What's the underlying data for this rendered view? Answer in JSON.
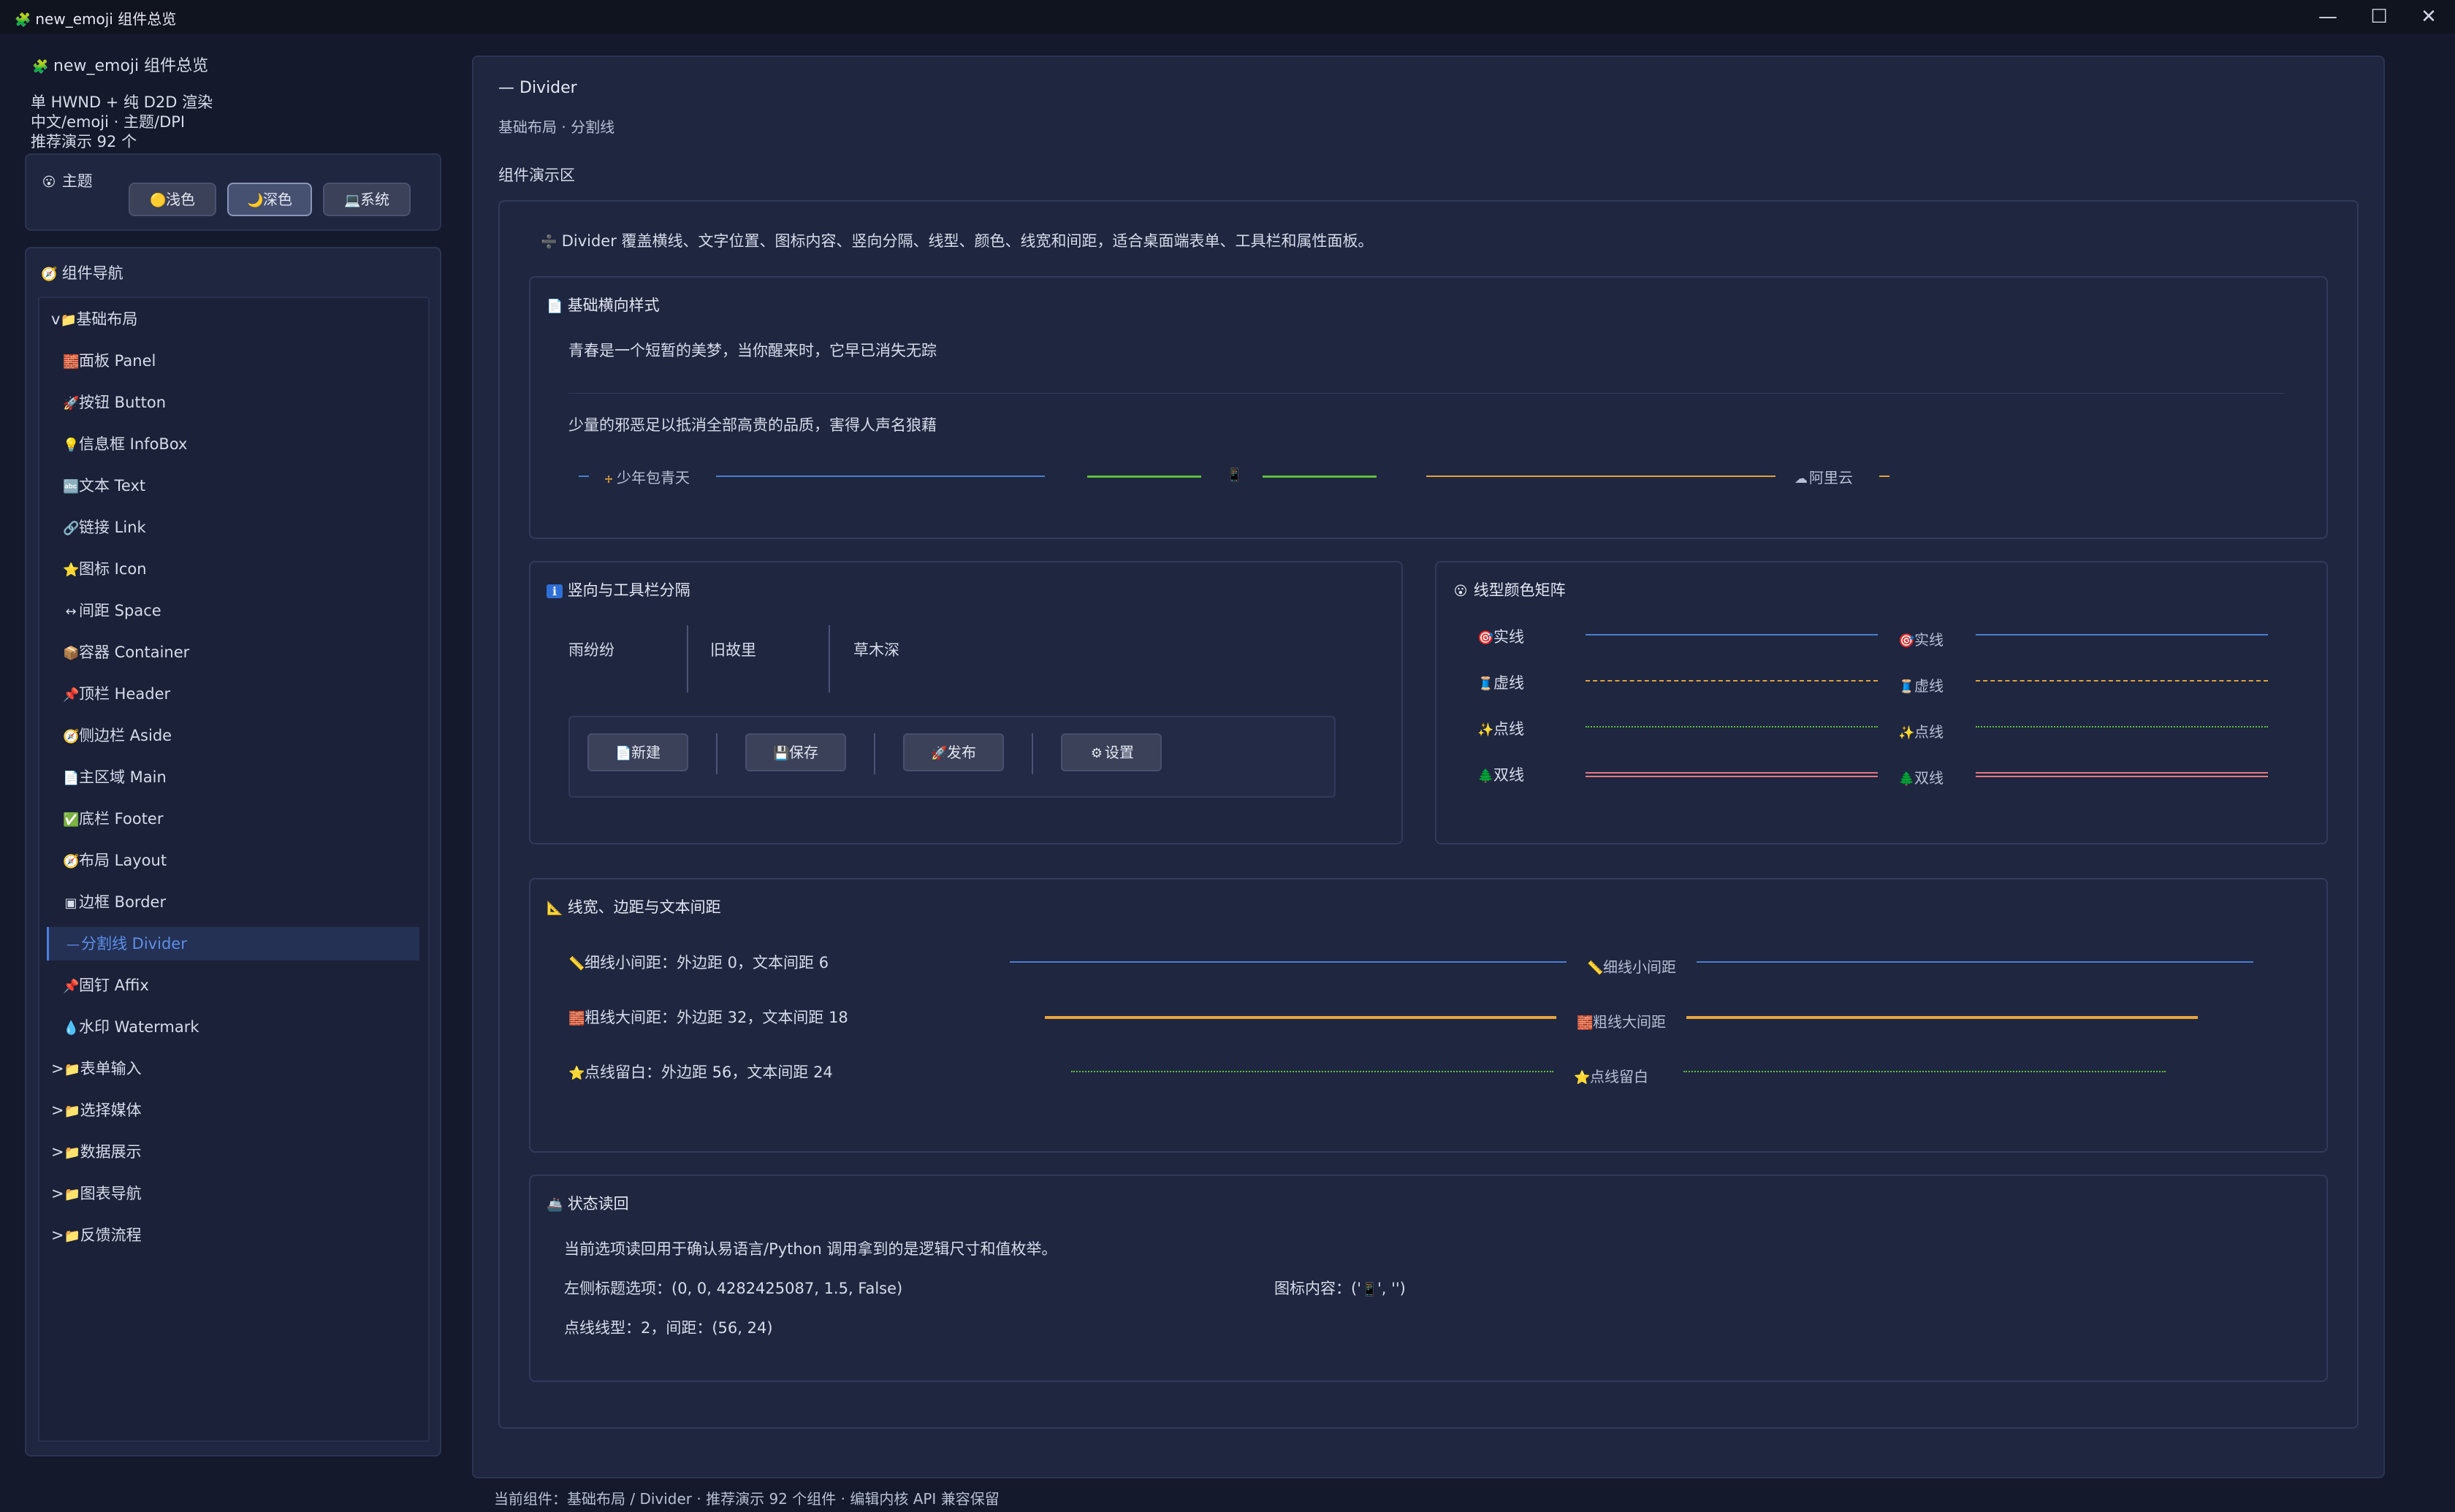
{
  "window": {
    "title": "new_emoji 组件总览",
    "icons": {
      "app": "🧩",
      "minimize": "—",
      "maximize": "☐",
      "close": "✕"
    }
  },
  "sidebar": {
    "app_title": "new_emoji 组件总览",
    "info": [
      "单 HWND + 纯 D2D 渲染",
      "中文/emoji · 主题/DPI",
      "推荐演示 92 个"
    ],
    "theme": {
      "icon": "😮",
      "label": "主题",
      "buttons": [
        {
          "icon": "🟡",
          "label": "浅色",
          "active": false
        },
        {
          "icon": "🌙",
          "label": "深色",
          "active": true
        },
        {
          "icon": "💻",
          "label": "系统",
          "active": false
        }
      ]
    },
    "nav": {
      "icon": "🧭",
      "title": "组件导航",
      "items": [
        {
          "prefix": "v",
          "icon": "📁",
          "label": "基础布局",
          "level": 0
        },
        {
          "icon": "🧱",
          "label": "面板 Panel",
          "level": 1
        },
        {
          "icon": "🚀",
          "label": "按钮 Button",
          "level": 1
        },
        {
          "icon": "💡",
          "label": "信息框 InfoBox",
          "level": 1
        },
        {
          "icon": "🔤",
          "label": "文本 Text",
          "level": 1
        },
        {
          "icon": "🔗",
          "label": "链接 Link",
          "level": 1
        },
        {
          "icon": "⭐",
          "label": "图标 Icon",
          "level": 1
        },
        {
          "icon": "↔",
          "label": "间距 Space",
          "level": 1
        },
        {
          "icon": "📦",
          "label": "容器 Container",
          "level": 1
        },
        {
          "icon": "📌",
          "label": "顶栏 Header",
          "level": 1
        },
        {
          "icon": "🧭",
          "label": "侧边栏 Aside",
          "level": 1
        },
        {
          "icon": "📄",
          "label": "主区域 Main",
          "level": 1
        },
        {
          "icon": "✅",
          "label": "底栏 Footer",
          "level": 1
        },
        {
          "icon": "🧭",
          "label": "布局 Layout",
          "level": 1
        },
        {
          "icon": "▣",
          "label": "边框 Border",
          "level": 1
        },
        {
          "icon": "—",
          "label": "分割线 Divider",
          "level": 1,
          "active": true
        },
        {
          "icon": "📌",
          "label": "固钉 Affix",
          "level": 1
        },
        {
          "icon": "💧",
          "label": "水印 Watermark",
          "level": 1
        },
        {
          "prefix": ">",
          "icon": "📁",
          "label": "表单输入",
          "level": 0
        },
        {
          "prefix": ">",
          "icon": "📁",
          "label": "选择媒体",
          "level": 0
        },
        {
          "prefix": ">",
          "icon": "📁",
          "label": "数据展示",
          "level": 0
        },
        {
          "prefix": ">",
          "icon": "📁",
          "label": "图表导航",
          "level": 0
        },
        {
          "prefix": ">",
          "icon": "📁",
          "label": "反馈流程",
          "level": 0
        }
      ]
    }
  },
  "main": {
    "title_icon": "—",
    "title": "Divider",
    "subtitle": "基础布局 · 分割线",
    "demo_label": "组件演示区",
    "intro_icon": "➗",
    "intro": "Divider 覆盖横线、文字位置、图标内容、竖向分隔、线型、颜色、线宽和间距，适合桌面端表单、工具栏和属性面板。",
    "basic": {
      "icon": "📄",
      "title": "基础横向样式",
      "line1": "青春是一个短暂的美梦，当你醒来时，它早已消失无踪",
      "line2": "少量的邪恶足以抵消全部高贵的品质，害得人声名狼藉",
      "left_text_icon": "🕂",
      "left_text": "少年包青天",
      "right_text_icon": "☁",
      "right_text": "阿里云",
      "center_icon": "📱"
    },
    "vertical": {
      "icon": "ℹ",
      "title": "竖向与工具栏分隔",
      "words": [
        "雨纷纷",
        "旧故里",
        "草木深"
      ],
      "toolbar": [
        {
          "icon": "📄",
          "label": "新建"
        },
        {
          "icon": "💾",
          "label": "保存"
        },
        {
          "icon": "🚀",
          "label": "发布"
        },
        {
          "icon": "⚙",
          "label": "设置"
        }
      ]
    },
    "matrix": {
      "icon": "😮",
      "title": "线型颜色矩阵",
      "rows": [
        {
          "icon": "🎯",
          "label": "实线",
          "color": "#4a7fcf",
          "style": "solid"
        },
        {
          "icon": "🧵",
          "label": "虚线",
          "color": "#e0a23b",
          "style": "dashed"
        },
        {
          "icon": "✨",
          "label": "点线",
          "color": "#5fbf3f",
          "style": "dotted"
        },
        {
          "icon": "🌲",
          "label": "双线",
          "color": "#e07a80",
          "style": "double"
        }
      ]
    },
    "widths": {
      "icon": "📐",
      "title": "线宽、边距与文本间距",
      "rows": [
        {
          "icon": "📏",
          "label": "细线小间距：外边距 0，文本间距 6",
          "tag": "细线小间距",
          "color": "#4a7fcf",
          "style": "solid",
          "thickness": 2
        },
        {
          "icon": "🧱",
          "label": "粗线大间距：外边距 32，文本间距 18",
          "tag": "粗线大间距",
          "color": "#e9a33b",
          "style": "solid",
          "thickness": 4
        },
        {
          "icon": "⭐",
          "label": "点线留白：外边距 56，文本间距 24",
          "tag": "点线留白",
          "color": "#5fbf3f",
          "style": "dotted",
          "thickness": 2
        }
      ]
    },
    "status": {
      "icon": "🚢",
      "title": "状态读回",
      "line1": "当前选项读回用于确认易语言/Python 调用拿到的是逻辑尺寸和值枚举。",
      "line2": "左侧标题选项：(0, 0, 4282425087, 1.5, False)",
      "line3_prefix": "图标内容：('",
      "line3_icon": "📱",
      "line3_suffix": "', '')",
      "line4": "点线线型：2，间距：(56, 24)"
    },
    "footer": "当前组件：基础布局 / Divider · 推荐演示 92 个组件 · 编辑内核 API 兼容保留"
  }
}
